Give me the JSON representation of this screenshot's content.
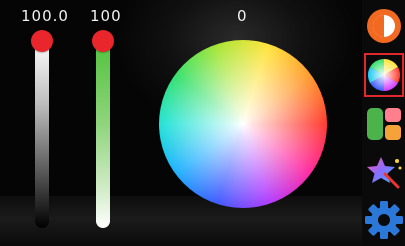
{
  "sliders": {
    "brightness_value": "100.0",
    "saturation_value": "100"
  },
  "wheel": {
    "hue_value": "0"
  },
  "toolbar": {
    "items": [
      "contrast-icon",
      "color-wheel-icon",
      "layout-icon",
      "effects-icon",
      "settings-icon"
    ],
    "selected": "color-wheel-icon"
  },
  "colors": {
    "knob": "#e8262b",
    "selection": "#e0282d",
    "accent_orange": "#f26a22",
    "settings_blue": "#2b78d8"
  }
}
